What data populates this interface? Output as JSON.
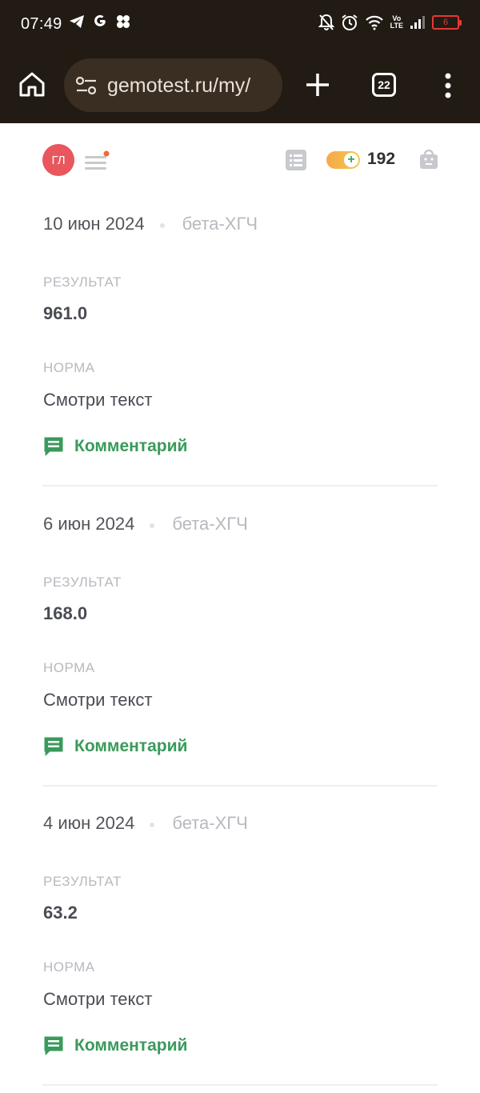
{
  "status_bar": {
    "time": "07:49",
    "network_label": "Vo\nLTE",
    "battery_level": "6",
    "icons": [
      "telegram-icon",
      "google-icon",
      "app-cluster-icon",
      "mute-bell-icon",
      "alarm-icon",
      "wifi-icon",
      "signal-icon",
      "battery-icon"
    ]
  },
  "browser": {
    "url": "gemotest.ru/my/",
    "tab_count": "22"
  },
  "header": {
    "avatar_initials": "ГЛ",
    "points": "192",
    "accent_colors": {
      "avatar": "#e9565d",
      "green": "#3a9a5b",
      "notification_dot": "#ef6a3a"
    }
  },
  "labels": {
    "result": "РЕЗУЛЬТАТ",
    "norm": "НОРМА",
    "comment": "Комментарий"
  },
  "records": [
    {
      "date": "10 июн 2024",
      "test": "бета-ХГЧ",
      "result": "961.0",
      "norm": "Смотри текст"
    },
    {
      "date": "6 июн 2024",
      "test": "бета-ХГЧ",
      "result": "168.0",
      "norm": "Смотри текст"
    },
    {
      "date": "4 июн 2024",
      "test": "бета-ХГЧ",
      "result": "63.2",
      "norm": "Смотри текст"
    }
  ]
}
